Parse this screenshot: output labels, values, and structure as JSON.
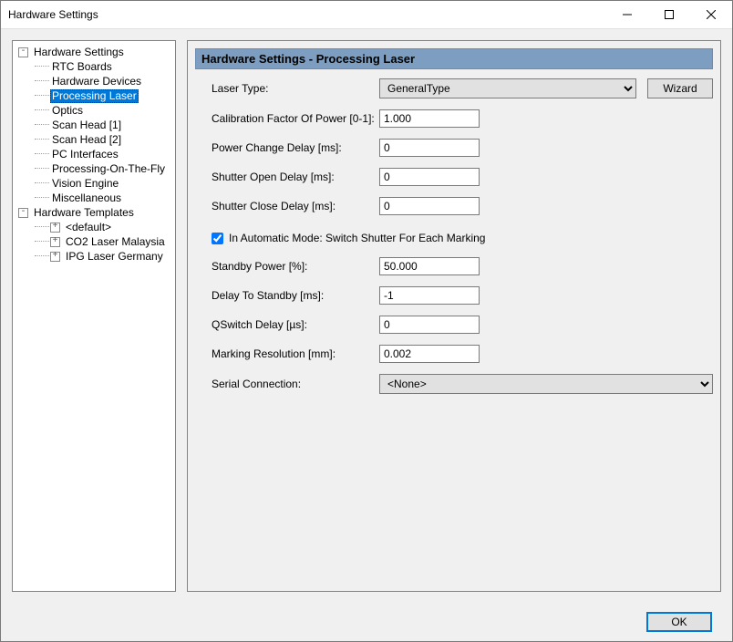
{
  "window": {
    "title": "Hardware Settings"
  },
  "tree": {
    "root1": "Hardware Settings",
    "items1": [
      "RTC Boards",
      "Hardware Devices",
      "Processing Laser",
      "Optics",
      "Scan Head [1]",
      "Scan Head [2]",
      "PC Interfaces",
      "Processing-On-The-Fly",
      "Vision Engine",
      "Miscellaneous"
    ],
    "selected1": 2,
    "root2": "Hardware Templates",
    "items2": [
      "<default>",
      "CO2 Laser Malaysia",
      "IPG Laser Germany"
    ]
  },
  "panel": {
    "title": "Hardware Settings - Processing Laser",
    "laserTypeLabel": "Laser Type:",
    "laserTypeValue": "GeneralType",
    "wizard": "Wizard",
    "calibLabel": "Calibration Factor Of Power [0-1]:",
    "calibValue": "1.000",
    "pcdLabel": "Power Change Delay [ms]:",
    "pcdValue": "0",
    "sodLabel": "Shutter Open Delay [ms]:",
    "sodValue": "0",
    "scdLabel": "Shutter Close Delay [ms]:",
    "scdValue": "0",
    "autoLabel": "In Automatic Mode: Switch Shutter For Each Marking",
    "standbyLabel": "Standby Power [%]:",
    "standbyValue": "50.000",
    "dtsLabel": "Delay To Standby [ms]:",
    "dtsValue": "-1",
    "qswLabel": "QSwitch Delay [µs]:",
    "qswValue": "0",
    "resLabel": "Marking Resolution [mm]:",
    "resValue": "0.002",
    "serialLabel": "Serial Connection:",
    "serialValue": "<None>"
  },
  "footer": {
    "ok": "OK"
  }
}
